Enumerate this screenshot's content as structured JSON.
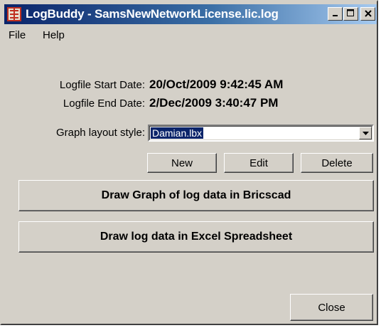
{
  "window": {
    "title": "LogBuddy - SamsNewNetworkLicense.lic.log"
  },
  "menu": {
    "file": "File",
    "help": "Help"
  },
  "logfile": {
    "start_label": "Logfile Start Date:",
    "start_value": "20/Oct/2009 9:42:45 AM",
    "end_label": "Logfile End Date:",
    "end_value": "2/Dec/2009 3:40:47 PM"
  },
  "layout": {
    "label": "Graph layout style:",
    "selected": "Damian.lbx"
  },
  "buttons": {
    "new": "New",
    "edit": "Edit",
    "delete": "Delete",
    "draw_graph": "Draw Graph of log data in Bricscad",
    "draw_excel": "Draw log data in Excel Spreadsheet",
    "close": "Close"
  },
  "colors": {
    "title_bar": "#0a246a",
    "face": "#d4d0c8",
    "selection": "#0a246a"
  },
  "icons": {
    "app": "app-icon",
    "minimize": "minimize-icon",
    "maximize": "maximize-icon",
    "close": "close-icon",
    "dropdown": "chevron-down-icon"
  }
}
